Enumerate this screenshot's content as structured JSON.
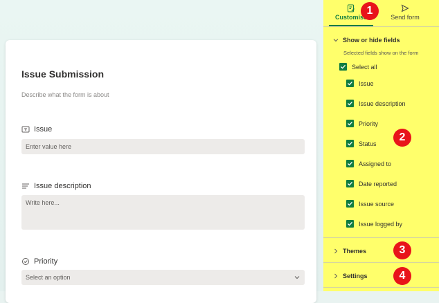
{
  "form": {
    "title": "Issue Submission",
    "description": "Describe what the form is about",
    "questions": [
      {
        "label": "Issue",
        "placeholder": "Enter value here",
        "icon": "textbox-icon"
      },
      {
        "label": "Issue description",
        "placeholder": "Write here...",
        "icon": "lines-icon"
      },
      {
        "label": "Priority",
        "placeholder": "Select an option",
        "icon": "check-circle-icon"
      }
    ]
  },
  "panel": {
    "tabs": [
      {
        "label": "Customise",
        "icon": "form-edit-icon",
        "active": true
      },
      {
        "label": "Send form",
        "icon": "send-icon",
        "active": false
      }
    ],
    "show_hide": {
      "title": "Show or hide fields",
      "subtitle": "Selected fields show on the form",
      "select_all": "Select all",
      "fields": [
        "Issue",
        "Issue description",
        "Priority",
        "Status",
        "Assigned to",
        "Date reported",
        "Issue source",
        "Issue logged by"
      ]
    },
    "themes_label": "Themes",
    "settings_label": "Settings"
  },
  "badges": [
    "1",
    "2",
    "3",
    "4"
  ],
  "colors": {
    "accent": "#107c41",
    "panel_bg": "#ffff6b",
    "badge": "#e8141a"
  }
}
